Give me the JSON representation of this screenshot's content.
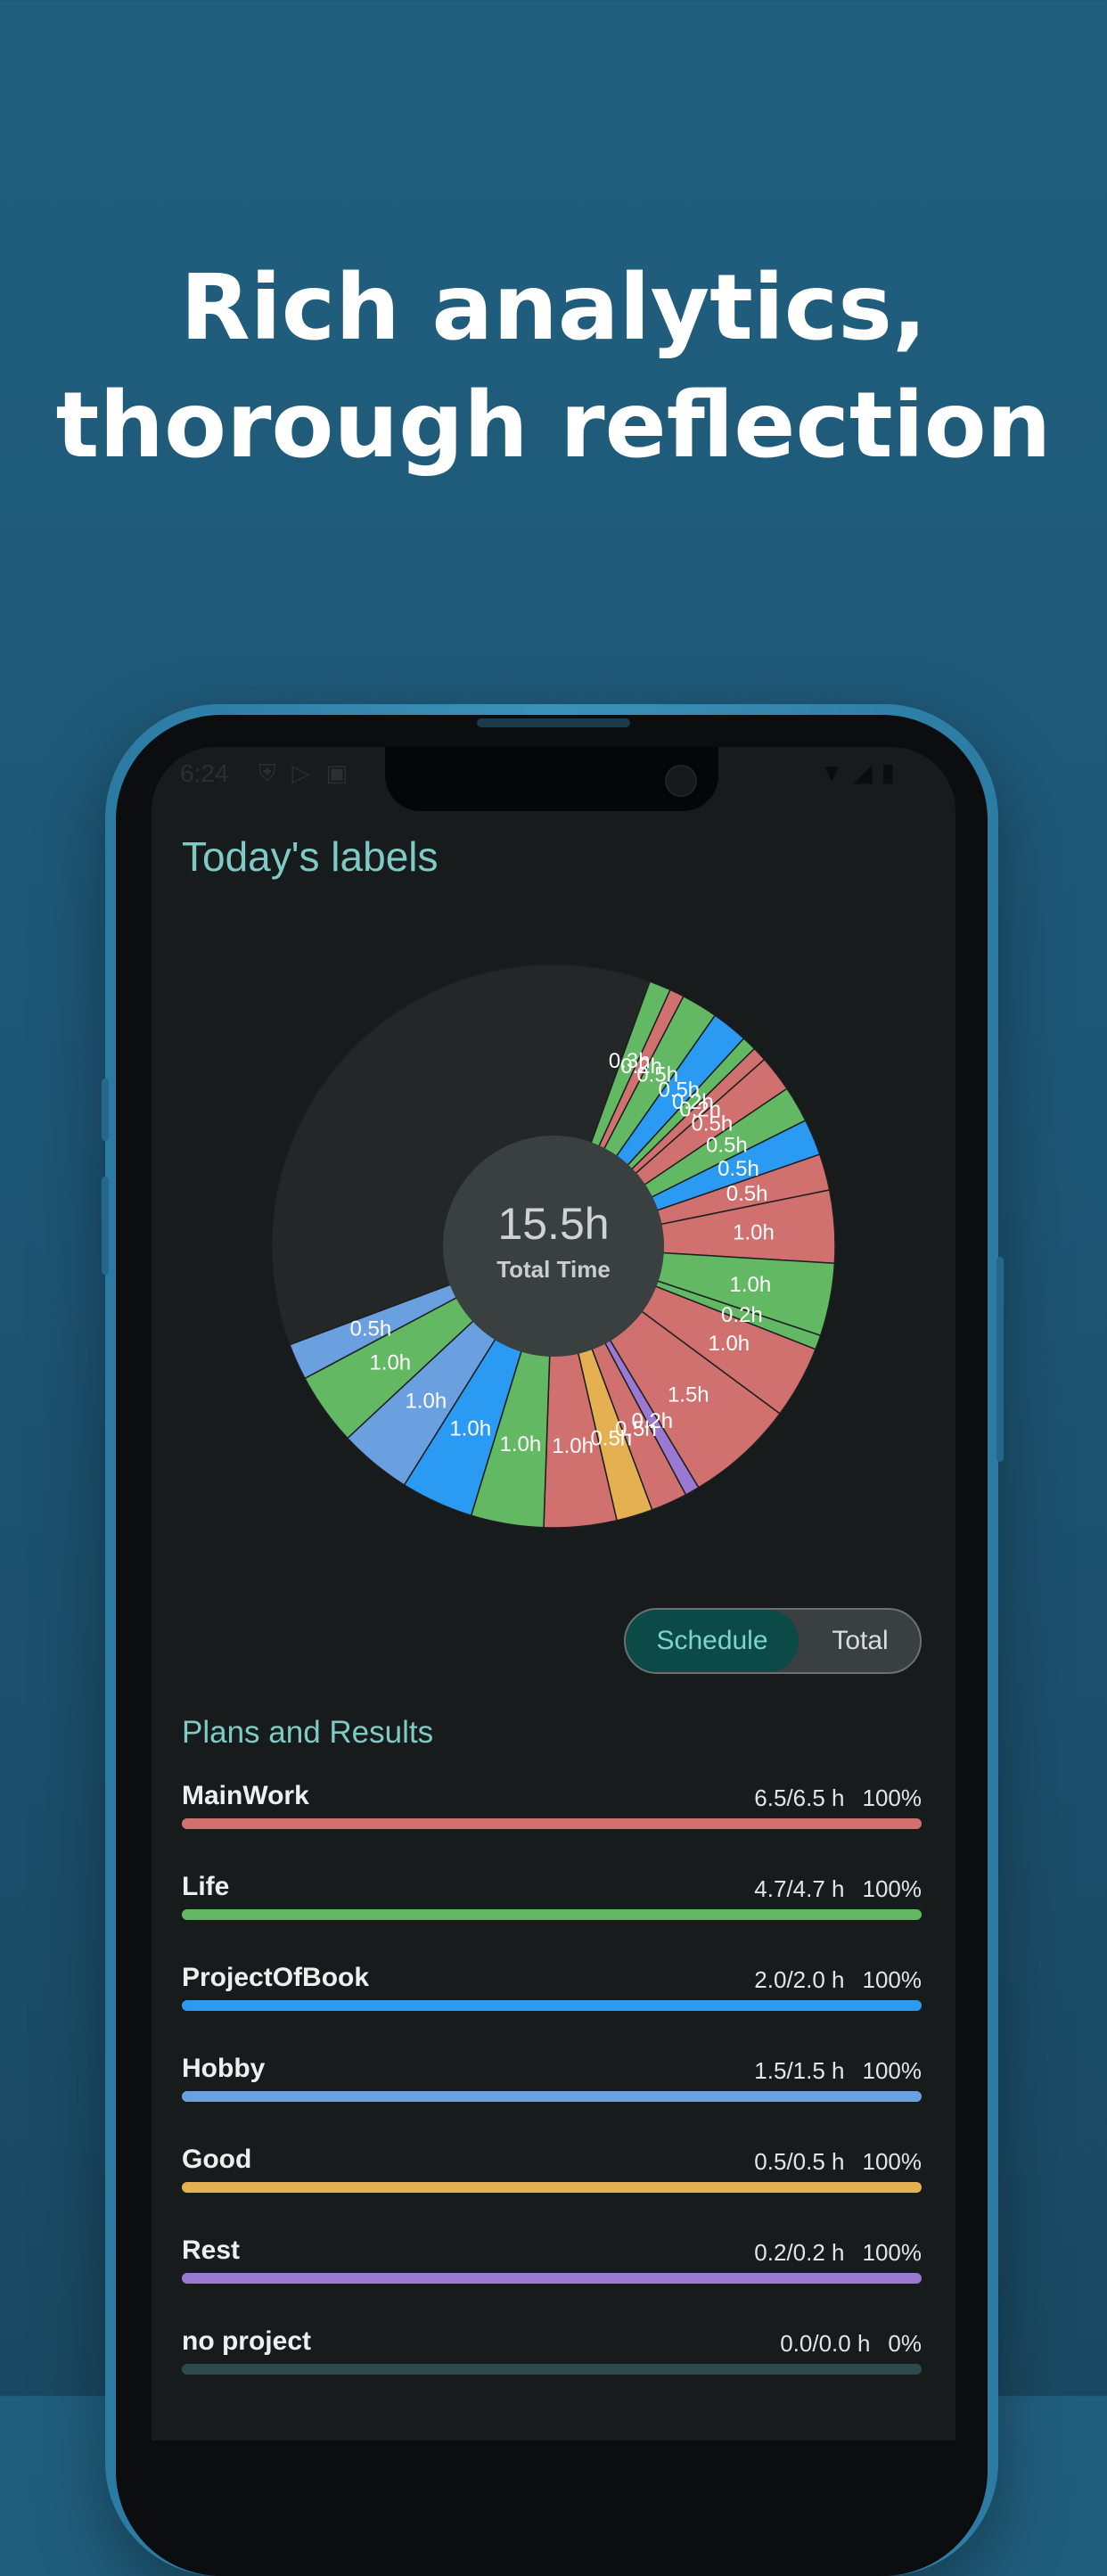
{
  "headline": {
    "line1": "Rich analytics,",
    "line2": "thorough reflection"
  },
  "status_bar": {
    "time": "6:24",
    "left_icons": [
      "shield-icon",
      "play-store-icon",
      "calendar-icon"
    ],
    "right_icons": [
      "wifi-icon",
      "signal-icon",
      "battery-icon"
    ]
  },
  "screen": {
    "title": "Today's labels",
    "total_time": "15.5h",
    "total_label": "Total Time"
  },
  "toggle": {
    "schedule": "Schedule",
    "total": "Total",
    "selected": "Schedule"
  },
  "plans": {
    "title": "Plans and Results",
    "items": [
      {
        "name": "MainWork",
        "values": "6.5/6.5 h",
        "percent": "100%",
        "progress": 100,
        "color": "#d0716f"
      },
      {
        "name": "Life",
        "values": "4.7/4.7 h",
        "percent": "100%",
        "progress": 100,
        "color": "#63b863"
      },
      {
        "name": "ProjectOfBook",
        "values": "2.0/2.0 h",
        "percent": "100%",
        "progress": 100,
        "color": "#2b9af3"
      },
      {
        "name": "Hobby",
        "values": "1.5/1.5 h",
        "percent": "100%",
        "progress": 100,
        "color": "#6a9fe0"
      },
      {
        "name": "Good",
        "values": "0.5/0.5 h",
        "percent": "100%",
        "progress": 100,
        "color": "#e5b052"
      },
      {
        "name": "Rest",
        "values": "0.2/0.2 h",
        "percent": "100%",
        "progress": 100,
        "color": "#9b78d2"
      },
      {
        "name": "no project",
        "values": "0.0/0.0 h",
        "percent": "0%",
        "progress": 0,
        "color": "#2f4a4c"
      }
    ]
  },
  "chart_data": {
    "type": "pie",
    "center_value": "15.5h",
    "center_label": "Total Time",
    "unit": "h",
    "total_hours": 24,
    "start_angle_deg": 70,
    "remainder_color": "#232728",
    "slices": [
      {
        "label": "0.3h",
        "value": 0.3,
        "color": "#63b863"
      },
      {
        "label": "0.2h",
        "value": 0.2,
        "color": "#d0716f"
      },
      {
        "label": "0.5h",
        "value": 0.5,
        "color": "#63b863"
      },
      {
        "label": "0.5h",
        "value": 0.5,
        "color": "#2b9af3"
      },
      {
        "label": "0.2h",
        "value": 0.2,
        "color": "#63b863"
      },
      {
        "label": "0.2h",
        "value": 0.2,
        "color": "#d0716f"
      },
      {
        "label": "0.5h",
        "value": 0.5,
        "color": "#d0716f"
      },
      {
        "label": "0.5h",
        "value": 0.5,
        "color": "#63b863"
      },
      {
        "label": "0.5h",
        "value": 0.5,
        "color": "#2b9af3"
      },
      {
        "label": "0.5h",
        "value": 0.5,
        "color": "#d0716f"
      },
      {
        "label": "1.0h",
        "value": 1.0,
        "color": "#d0716f"
      },
      {
        "label": "1.0h",
        "value": 1.0,
        "color": "#63b863"
      },
      {
        "label": "0.2h",
        "value": 0.2,
        "color": "#63b863"
      },
      {
        "label": "1.0h",
        "value": 1.0,
        "color": "#d0716f"
      },
      {
        "label": "1.5h",
        "value": 1.5,
        "color": "#d0716f"
      },
      {
        "label": "0.2h",
        "value": 0.2,
        "color": "#9b78d2"
      },
      {
        "label": "0.5h",
        "value": 0.5,
        "color": "#d0716f"
      },
      {
        "label": "0.5h",
        "value": 0.5,
        "color": "#e5b052"
      },
      {
        "label": "1.0h",
        "value": 1.0,
        "color": "#d0716f"
      },
      {
        "label": "1.0h",
        "value": 1.0,
        "color": "#63b863"
      },
      {
        "label": "1.0h",
        "value": 1.0,
        "color": "#2b9af3"
      },
      {
        "label": "1.0h",
        "value": 1.0,
        "color": "#6a9fe0"
      },
      {
        "label": "1.0h",
        "value": 1.0,
        "color": "#63b863"
      },
      {
        "label": "0.5h",
        "value": 0.5,
        "color": "#6a9fe0"
      }
    ]
  }
}
